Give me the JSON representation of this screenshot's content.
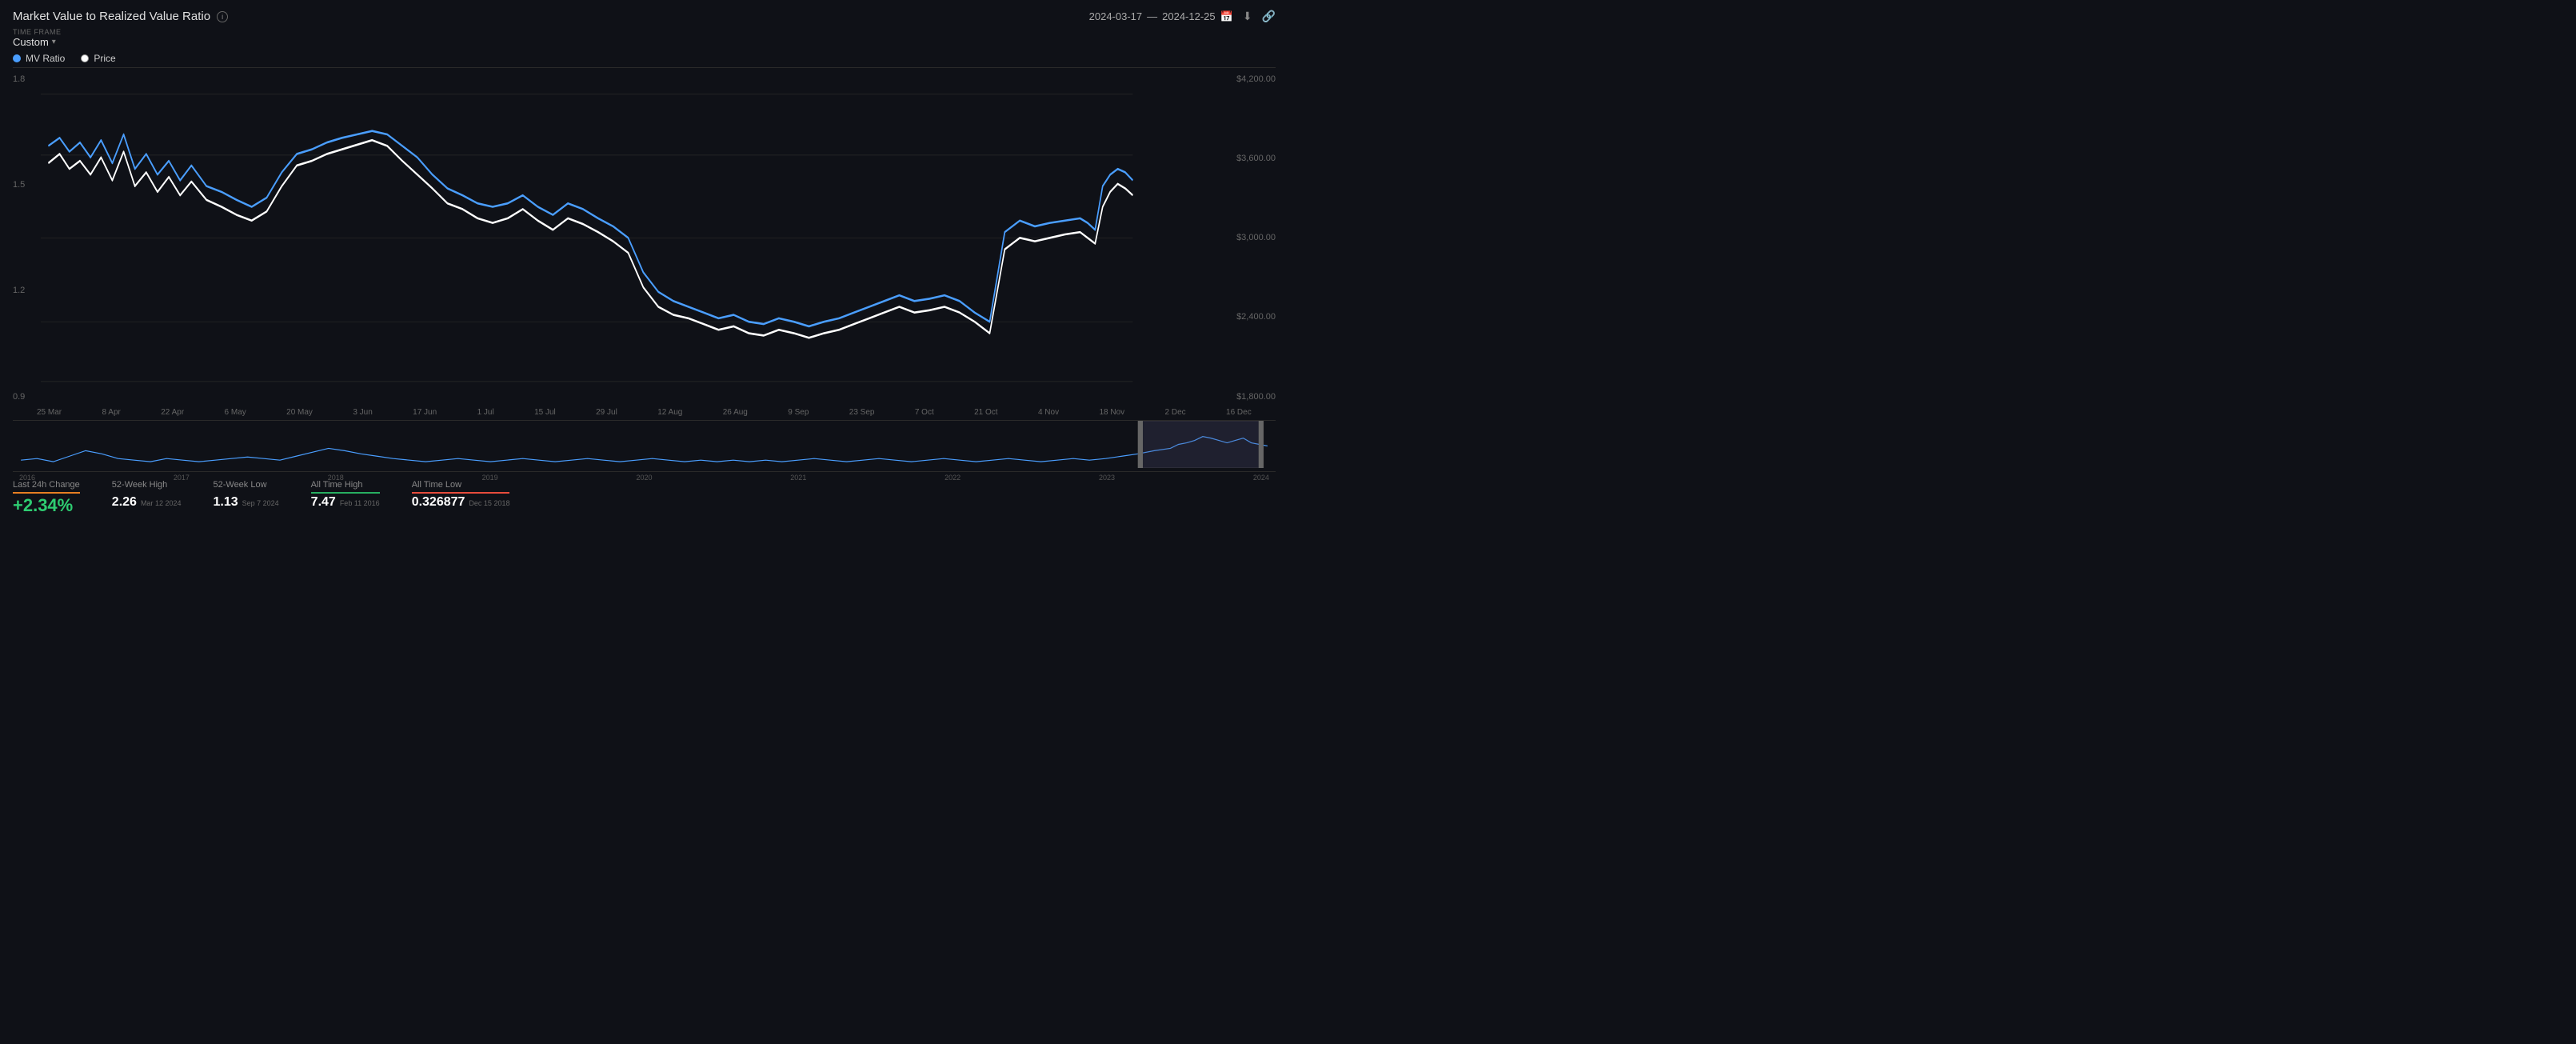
{
  "header": {
    "title": "Market Value to Realized Value Ratio",
    "info_label": "i",
    "date_start": "2024-03-17",
    "date_separator": "—",
    "date_end": "2024-12-25"
  },
  "timeframe": {
    "label": "TIME FRAME",
    "value": "Custom",
    "chevron": "▾"
  },
  "legend": {
    "items": [
      {
        "label": "MV Ratio",
        "type": "blue"
      },
      {
        "label": "Price",
        "type": "white"
      }
    ]
  },
  "yaxis_left": [
    "1.8",
    "1.5",
    "1.2",
    "0.9"
  ],
  "yaxis_right": [
    "$4,200.00",
    "$3,600.00",
    "$3,000.00",
    "$2,400.00",
    "$1,800.00"
  ],
  "xaxis": [
    "25 Mar",
    "8 Apr",
    "22 Apr",
    "6 May",
    "20 May",
    "3 Jun",
    "17 Jun",
    "1 Jul",
    "15 Jul",
    "29 Jul",
    "12 Aug",
    "26 Aug",
    "9 Sep",
    "23 Sep",
    "7 Oct",
    "21 Oct",
    "4 Nov",
    "18 Nov",
    "2 Dec",
    "16 Dec"
  ],
  "mini_labels": [
    "2016",
    "2017",
    "2018",
    "2019",
    "2020",
    "2021",
    "2022",
    "2023",
    "2024"
  ],
  "stats": [
    {
      "label": "Last 24h Change",
      "underline": "orange",
      "value": "+2.34%",
      "date": ""
    },
    {
      "label": "52-Week High",
      "underline": "none",
      "value": "2.26",
      "date": "Mar 12 2024"
    },
    {
      "label": "52-Week Low",
      "underline": "none",
      "value": "1.13",
      "date": "Sep 7 2024"
    },
    {
      "label": "All Time High",
      "underline": "green",
      "value": "7.47",
      "date": "Feb 11 2016"
    },
    {
      "label": "All Time Low",
      "underline": "red",
      "value": "0.326877",
      "date": "Dec 15 2018"
    }
  ],
  "colors": {
    "background": "#0f1117",
    "grid": "#2a2a2a",
    "blue_line": "#4a9eff",
    "white_line": "#ffffff",
    "text_dim": "#666666"
  }
}
